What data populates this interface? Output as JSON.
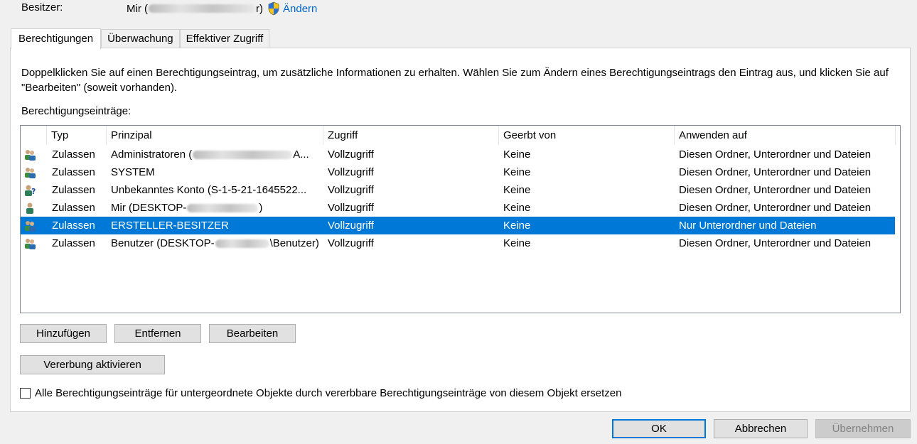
{
  "owner": {
    "label": "Besitzer:",
    "value_prefix": "Mir (",
    "value_suffix": "r)",
    "change_label": "Ändern"
  },
  "tabs": [
    {
      "label": "Berechtigungen",
      "active": true
    },
    {
      "label": "Überwachung",
      "active": false
    },
    {
      "label": "Effektiver Zugriff",
      "active": false
    }
  ],
  "description": "Doppelklicken Sie auf einen Berechtigungseintrag, um zusätzliche Informationen zu erhalten. Wählen Sie zum Ändern eines Berechtigungseintrags den Eintrag aus, und klicken Sie auf \"Bearbeiten\" (soweit vorhanden).",
  "entries_label": "Berechtigungseinträge:",
  "columns": {
    "type": "Typ",
    "principal": "Prinzipal",
    "access": "Zugriff",
    "inherited": "Geerbt von",
    "applies": "Anwenden auf"
  },
  "rows": [
    {
      "icon": "group-users-icon",
      "type": "Zulassen",
      "principal_prefix": "Administratoren (",
      "principal_suffix": "A...",
      "access": "Vollzugriff",
      "inherited": "Keine",
      "applies": "Diesen Ordner, Unterordner und Dateien"
    },
    {
      "icon": "group-users-icon",
      "type": "Zulassen",
      "principal_prefix": "SYSTEM",
      "principal_suffix": "",
      "access": "Vollzugriff",
      "inherited": "Keine",
      "applies": "Diesen Ordner, Unterordner und Dateien"
    },
    {
      "icon": "unknown-user-icon",
      "type": "Zulassen",
      "principal_prefix": "Unbekanntes Konto (S-1-5-21-1645522...",
      "principal_suffix": "",
      "access": "Vollzugriff",
      "inherited": "Keine",
      "applies": "Diesen Ordner, Unterordner und Dateien"
    },
    {
      "icon": "single-user-icon",
      "type": "Zulassen",
      "principal_prefix": "Mir (DESKTOP-",
      "principal_suffix": ")",
      "access": "Vollzugriff",
      "inherited": "Keine",
      "applies": "Diesen Ordner, Unterordner und Dateien"
    },
    {
      "icon": "group-users-icon",
      "type": "Zulassen",
      "principal_prefix": "ERSTELLER-BESITZER",
      "principal_suffix": "",
      "access": "Vollzugriff",
      "inherited": "Keine",
      "applies": "Nur Unterordner und Dateien",
      "selected": true
    },
    {
      "icon": "group-users-icon",
      "type": "Zulassen",
      "principal_prefix": "Benutzer (DESKTOP-",
      "principal_suffix": "\\Benutzer)",
      "access": "Vollzugriff",
      "inherited": "Keine",
      "applies": "Diesen Ordner, Unterordner und Dateien"
    }
  ],
  "buttons": {
    "add": "Hinzufügen",
    "remove": "Entfernen",
    "edit": "Bearbeiten",
    "enable_inheritance": "Vererbung aktivieren",
    "ok": "OK",
    "cancel": "Abbrechen",
    "apply": "Übernehmen"
  },
  "replace_checkbox": {
    "label": "Alle Berechtigungseinträge für untergeordnete Objekte durch vererbbare Berechtigungseinträge von diesem Objekt ersetzen",
    "checked": false
  },
  "colors": {
    "selection": "#0078d7",
    "link": "#0066cc"
  }
}
